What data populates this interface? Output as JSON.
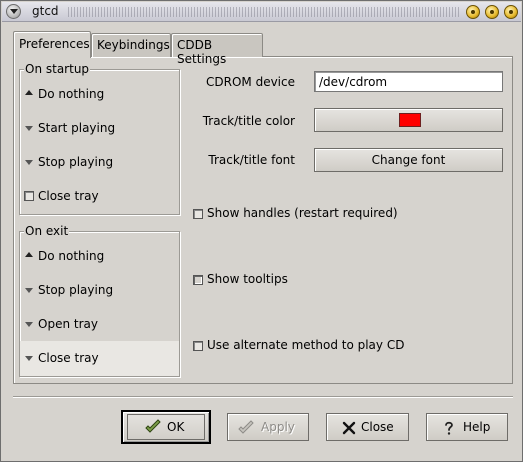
{
  "window": {
    "title": "gtcd"
  },
  "tabs": [
    {
      "label": "Preferences",
      "active": true
    },
    {
      "label": "Keybindings",
      "active": false
    },
    {
      "label": "CDDB Settings",
      "active": false
    }
  ],
  "startup": {
    "title": "On startup",
    "options": [
      {
        "label": "Do nothing",
        "selected": true
      },
      {
        "label": "Start playing",
        "selected": false
      },
      {
        "label": "Stop playing",
        "selected": false
      }
    ],
    "close_tray_label": "Close tray",
    "close_tray_checked": false
  },
  "exit": {
    "title": "On exit",
    "options": [
      {
        "label": "Do nothing",
        "selected": true
      },
      {
        "label": "Stop playing",
        "selected": false
      },
      {
        "label": "Open tray",
        "selected": false
      },
      {
        "label": "Close tray",
        "selected": false
      }
    ]
  },
  "settings": {
    "cdrom_label": "CDROM device",
    "cdrom_value": "/dev/cdrom",
    "color_label": "Track/title color",
    "color_value": "#ff0000",
    "font_label": "Track/title font",
    "font_button": "Change font"
  },
  "checks": {
    "handles_label": "Show handles (restart required)",
    "handles_checked": false,
    "tooltips_label": "Show tooltips",
    "tooltips_checked": true,
    "alt_label": "Use alternate method to play CD",
    "alt_checked": false
  },
  "buttons": {
    "ok": "OK",
    "apply": "Apply",
    "close": "Close",
    "help": "Help"
  },
  "icons": {
    "window_menu": "window-menu-icon",
    "ok": "check-icon",
    "apply": "check-icon",
    "close": "x-icon",
    "help": "question-icon"
  }
}
